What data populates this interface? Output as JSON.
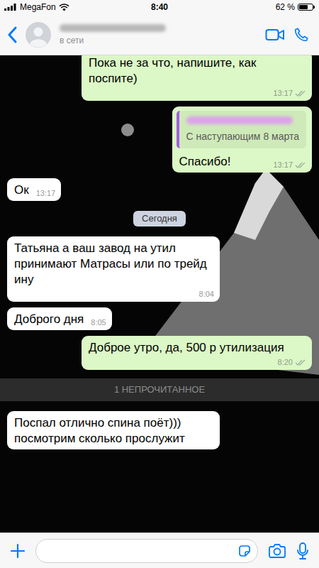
{
  "status_bar": {
    "carrier": "MegaFon",
    "time": "8:40",
    "battery": {
      "text": "62 %",
      "level": 0.62
    }
  },
  "header": {
    "status": "в сети"
  },
  "messages": [
    {
      "kind": "text",
      "direction": "out",
      "text": "Пока не за что, напишите, как поспите)",
      "time": "13:17",
      "read": false
    },
    {
      "kind": "quote",
      "direction": "out",
      "quote_text": "С наступающим 8 марта",
      "text": "Спасибо!",
      "time": "13:17",
      "read": false
    },
    {
      "kind": "text",
      "direction": "in",
      "text": "Ок",
      "time": "13:17"
    },
    {
      "kind": "date",
      "text": "Сегодня"
    },
    {
      "kind": "text",
      "direction": "in",
      "text": "Татьяна а ваш завод на утил принимают Матрасы или по трейд ину",
      "time": "8:04"
    },
    {
      "kind": "text",
      "direction": "in",
      "text": "Доброго дня",
      "time": "8:05"
    },
    {
      "kind": "text",
      "direction": "out",
      "text": "Доброе утро, да, 500 р утилизация",
      "time": "8:20",
      "read": false
    },
    {
      "kind": "unread",
      "text": "1 НЕПРОЧИТАННОЕ"
    },
    {
      "kind": "text",
      "direction": "in",
      "text": "Поспал отлично спина поёт))) посмотрим сколько прослужит"
    }
  ]
}
